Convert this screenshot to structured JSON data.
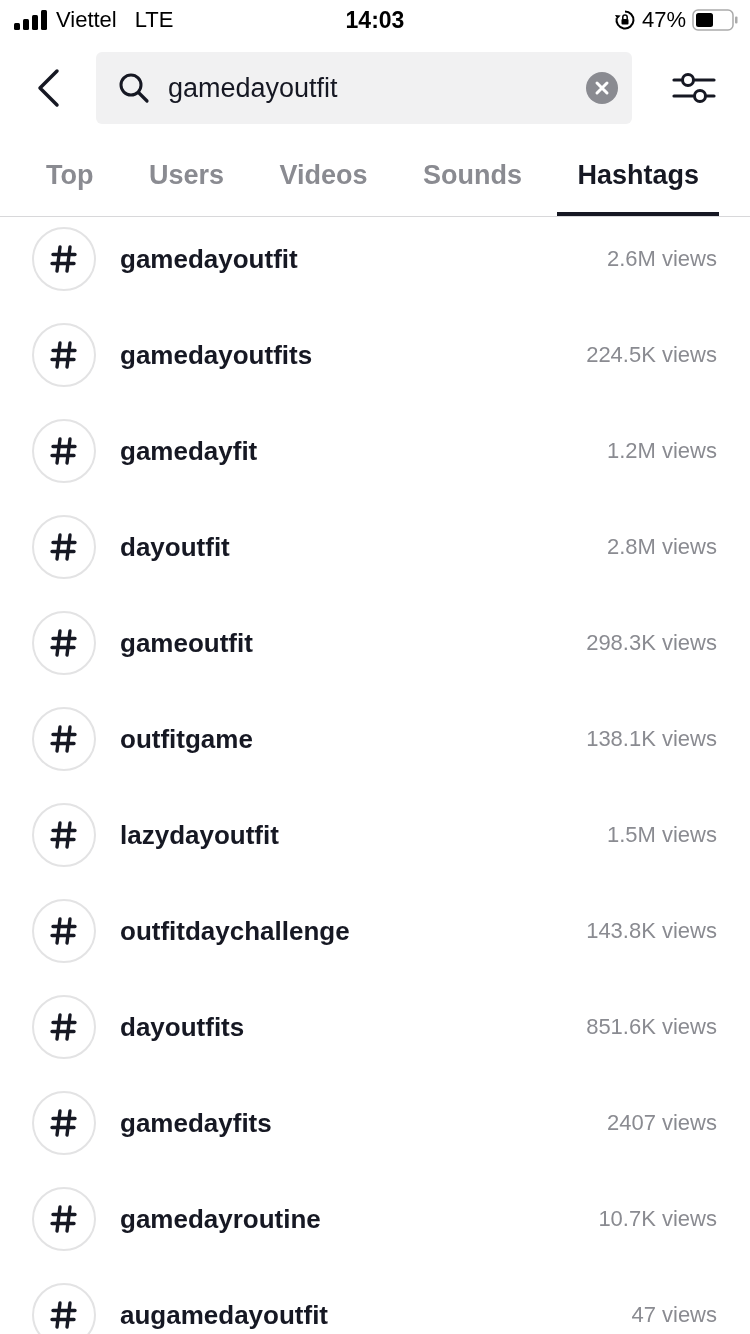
{
  "status_bar": {
    "carrier": "Viettel",
    "network": "LTE",
    "time": "14:03",
    "battery": "47%"
  },
  "search": {
    "value": "gamedayoutfit"
  },
  "tabs": [
    {
      "label": "Top",
      "selected": false
    },
    {
      "label": "Users",
      "selected": false
    },
    {
      "label": "Videos",
      "selected": false
    },
    {
      "label": "Sounds",
      "selected": false
    },
    {
      "label": "Hashtags",
      "selected": true
    }
  ],
  "hashtags": [
    {
      "name": "gamedayoutfit",
      "views": "2.6M views"
    },
    {
      "name": "gamedayoutfits",
      "views": "224.5K views"
    },
    {
      "name": "gamedayfit",
      "views": "1.2M views"
    },
    {
      "name": "dayoutfit",
      "views": "2.8M views"
    },
    {
      "name": "gameoutfit",
      "views": "298.3K views"
    },
    {
      "name": "outfitgame",
      "views": "138.1K views"
    },
    {
      "name": "lazydayoutfit",
      "views": "1.5M views"
    },
    {
      "name": "outfitdaychallenge",
      "views": "143.8K views"
    },
    {
      "name": "dayoutfits",
      "views": "851.6K views"
    },
    {
      "name": "gamedayfits",
      "views": "2407 views"
    },
    {
      "name": "gamedayroutine",
      "views": "10.7K views"
    },
    {
      "name": "augamedayoutfit",
      "views": "47 views"
    }
  ]
}
